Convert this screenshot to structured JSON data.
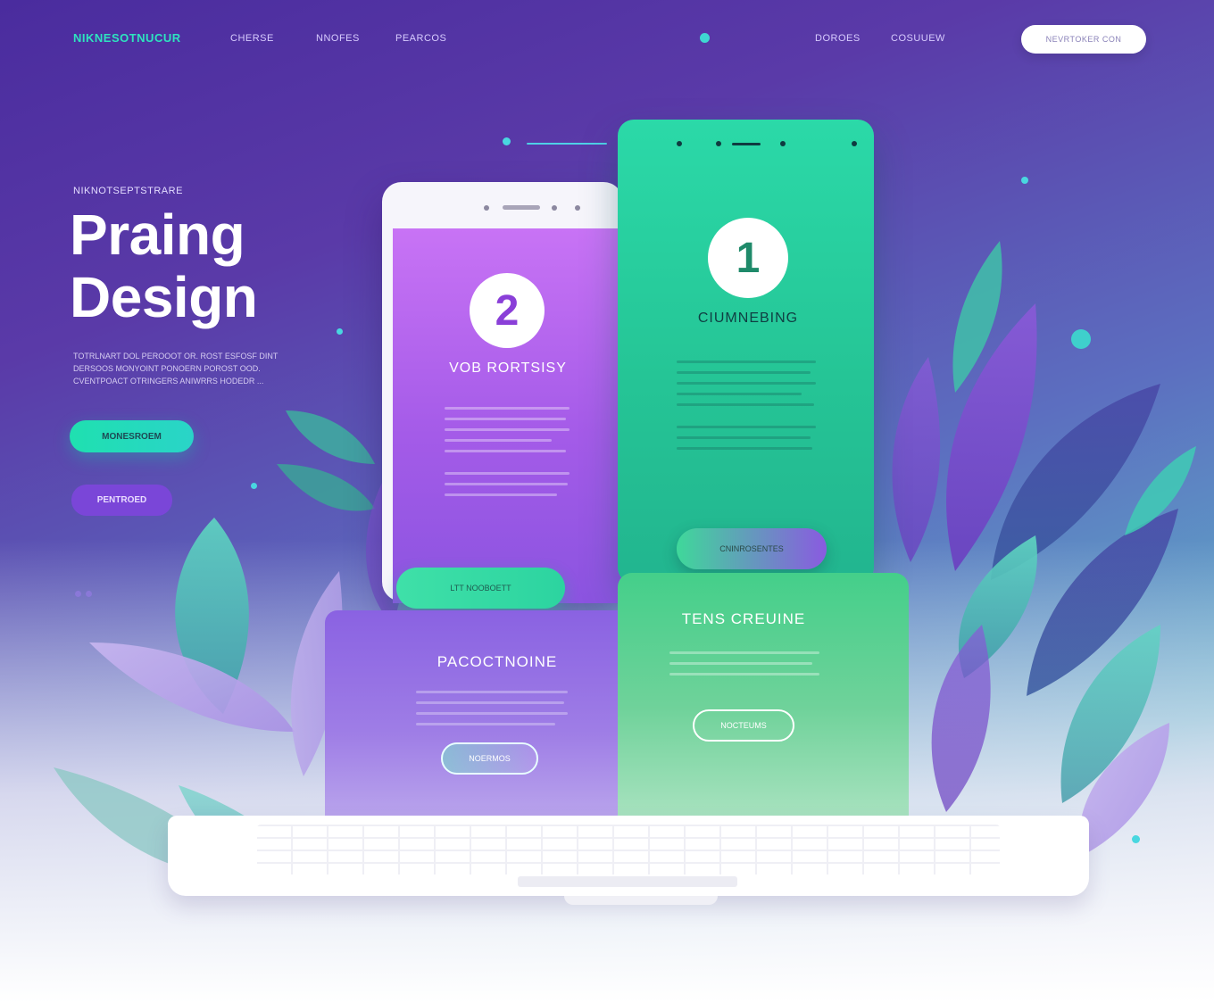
{
  "nav": {
    "logo": "NIKNESOTNUCUR",
    "links": [
      "CHERSE",
      "NNOFES",
      "PEARCOS"
    ],
    "right_links": [
      "DOROES",
      "COSUUEW"
    ],
    "cta_label": "NEVRTOKER CON"
  },
  "hero": {
    "eyebrow": "NIKNOTSEPTSTRARE",
    "title_line1": "Praing",
    "title_line2": "Design",
    "description": "TOTRLNART DOL PEROOOT OR. ROST ESFOSF DINT DERSOOS MONYOINT PONOERN POROST OOD. CVENTPOACT OTRINGERS ANIWRRS HODEDR ...",
    "primary_button": "MONESROEM",
    "secondary_button": "PENTROED"
  },
  "phone_card": {
    "step": "2",
    "heading": "VOB RORTSISY",
    "button": "LTT NOOBOETT"
  },
  "green_card": {
    "step": "1",
    "heading": "CIUMNEBING",
    "button": "CNINROSENTES"
  },
  "purple_panel": {
    "heading": "PACOCTNOINE",
    "button": "NOERMOS"
  },
  "green_panel": {
    "heading": "TENS CREUINE",
    "button": "NOCTEUMS"
  },
  "colors": {
    "accent_teal": "#2ee3bf",
    "accent_purple": "#7a46d8",
    "card_green": "#2bd9a8",
    "card_purple": "#b06cf0"
  }
}
